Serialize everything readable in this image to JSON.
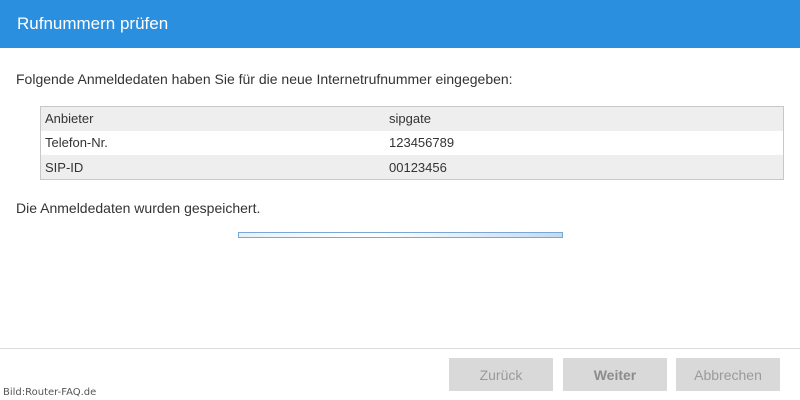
{
  "window": {
    "title": "Rufnummern prüfen"
  },
  "intro_text": "Folgende Anmeldedaten haben Sie für die neue Internetrufnummer eingegeben:",
  "credentials": [
    {
      "label": "Anbieter",
      "value": "sipgate"
    },
    {
      "label": "Telefon-Nr.",
      "value": "123456789"
    },
    {
      "label": "SIP-ID",
      "value": "00123456"
    }
  ],
  "status_text": "Die Anmeldedaten wurden gespeichert.",
  "progress": {
    "fraction": 1.0
  },
  "buttons": {
    "back": "Zurück",
    "next": "Weiter",
    "cancel": "Abbrechen"
  },
  "credit": "Bild:Router-FAQ.de",
  "colors": {
    "titlebar": "#2b8fe0",
    "button_bg": "#d9d9d9"
  }
}
